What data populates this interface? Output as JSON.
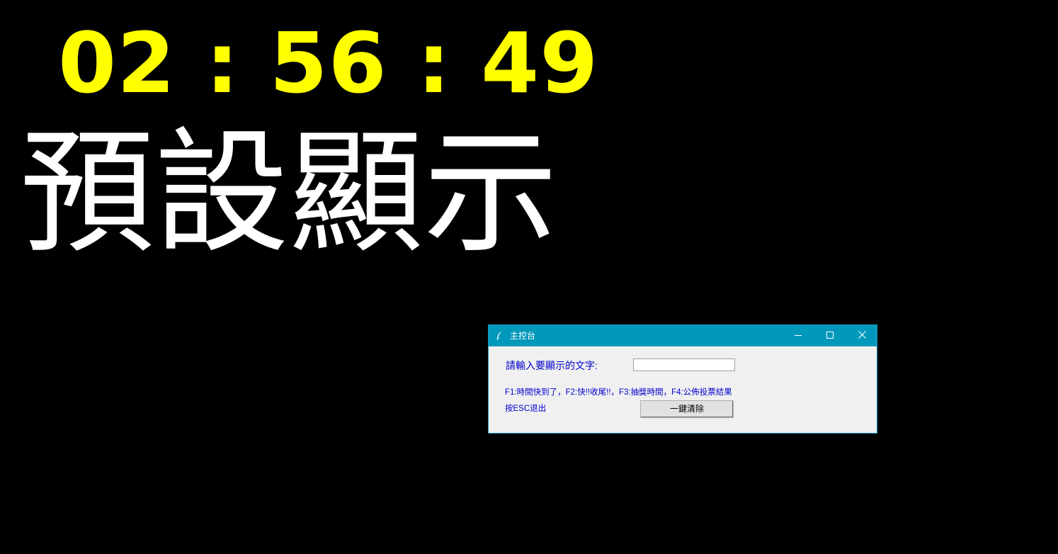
{
  "clock": {
    "time": "02 : 56 : 49",
    "color": "#ffff00"
  },
  "display": {
    "text": "預設顯示",
    "color": "#ffffff"
  },
  "window": {
    "title": "主控台",
    "title_icon": "feather-icon",
    "titlebar_color": "#0099bc",
    "controls": {
      "minimize_icon": "minimize-icon",
      "maximize_icon": "maximize-icon",
      "close_icon": "close-icon"
    },
    "prompt_label": "請輸入要顯示的文字:",
    "input_value": "",
    "hint": "F1:時間快到了，F2:快!!收尾!!，F3:抽獎時間，F4:公佈投票結果",
    "esc_hint": "按ESC退出",
    "clear_button_label": "一鍵清除",
    "text_color": "#0000cc"
  }
}
